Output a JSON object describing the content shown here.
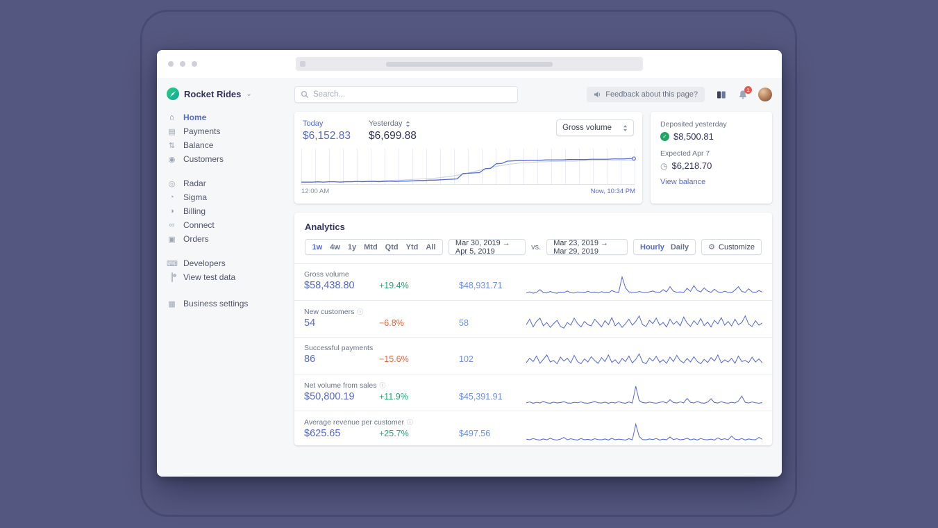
{
  "colors": {
    "accent_blue": "#5469d4",
    "compare_blue": "#6c8eef",
    "positive_green": "#1ea672",
    "negative_orange": "#e8633c",
    "brand_green": "#24b47e",
    "badge_red": "#e25950"
  },
  "icon_glyphs": {
    "home-icon": "⌂",
    "payments-icon": "▤",
    "balance-icon": "⇅",
    "customers-icon": "◉",
    "radar-icon": "◎",
    "sigma-icon": "◔",
    "billing-icon": "◑",
    "connect-icon": "∞",
    "orders-icon": "▣",
    "developers-icon": "⌨",
    "settings-icon": "▦",
    "clock-icon": "◷",
    "gear-icon": "⚙",
    "info-icon": "ⓘ",
    "check-icon": "✓",
    "chevron-down-icon": "⌄"
  },
  "topbar": {
    "search_placeholder": "Search...",
    "feedback_label": "Feedback about this page?",
    "notification_count": "1"
  },
  "sidebar": {
    "account_name": "Rocket Rides",
    "groups": [
      {
        "items": [
          {
            "label": "Home",
            "icon": "home-icon",
            "active": true
          },
          {
            "label": "Payments",
            "icon": "payments-icon"
          },
          {
            "label": "Balance",
            "icon": "balance-icon"
          },
          {
            "label": "Customers",
            "icon": "customers-icon"
          }
        ]
      },
      {
        "items": [
          {
            "label": "Radar",
            "icon": "radar-icon"
          },
          {
            "label": "Sigma",
            "icon": "sigma-icon"
          },
          {
            "label": "Billing",
            "icon": "billing-icon"
          },
          {
            "label": "Connect",
            "icon": "connect-icon"
          },
          {
            "label": "Orders",
            "icon": "orders-icon"
          }
        ]
      },
      {
        "items": [
          {
            "label": "Developers",
            "icon": "developers-icon"
          },
          {
            "label": "View test data",
            "icon": "toggle-icon"
          }
        ]
      },
      {
        "items": [
          {
            "label": "Business settings",
            "icon": "settings-icon"
          }
        ]
      }
    ]
  },
  "overview": {
    "today_label": "Today",
    "today_value": "$6,152.83",
    "yesterday_label": "Yesterday",
    "yesterday_value": "$6,699.88",
    "metric_select_value": "Gross volume",
    "x_start": "12:00 AM",
    "x_end": "Now, 10:34 PM",
    "chart": {
      "type": "line",
      "today": [
        4,
        4,
        4,
        5,
        4,
        5,
        5,
        4,
        5,
        5,
        6,
        5,
        6,
        6,
        5,
        6,
        7,
        6,
        7,
        7,
        8,
        9,
        9,
        10,
        10,
        11,
        12,
        13,
        14,
        30,
        31,
        32,
        33,
        45,
        46,
        60,
        61,
        68,
        69,
        70,
        70,
        71,
        71,
        71,
        72,
        72,
        72,
        72,
        73,
        73,
        73,
        73,
        74,
        74,
        74,
        74,
        75,
        75,
        75,
        76,
        76
      ],
      "yesterday": [
        3,
        3,
        4,
        4,
        4,
        5,
        5,
        5,
        6,
        6,
        6,
        7,
        7,
        8,
        8,
        9,
        9,
        10,
        10,
        11,
        12,
        13,
        14,
        15,
        16,
        18,
        20,
        22,
        25,
        28,
        32,
        36,
        40,
        44,
        48,
        52,
        55,
        58,
        60,
        62,
        63,
        64,
        65,
        66,
        66,
        67,
        67,
        68,
        68,
        68,
        69,
        69,
        69,
        70,
        70,
        70,
        70,
        71,
        71,
        71,
        71
      ]
    }
  },
  "deposits": {
    "deposited_label": "Deposited yesterday",
    "deposited_value": "$8,500.81",
    "expected_label": "Expected Apr 7",
    "expected_value": "$6,218.70",
    "link_label": "View balance"
  },
  "analytics": {
    "title": "Analytics",
    "periods": [
      "1w",
      "4w",
      "1y",
      "Mtd",
      "Qtd",
      "Ytd",
      "All"
    ],
    "active_period": "1w",
    "range_primary": "Mar 30, 2019 → Apr 5, 2019",
    "vs_label": "vs.",
    "range_compare": "Mar 23, 2019 → Mar 29, 2019",
    "interval_hourly": "Hourly",
    "interval_daily": "Daily",
    "active_interval": "Hourly",
    "customize_label": "Customize",
    "rows": [
      {
        "label": "Gross volume",
        "info": false,
        "value": "$58,438.80",
        "change": "+19.4%",
        "compare": "$48,931.71",
        "spark": [
          8,
          12,
          6,
          10,
          22,
          9,
          7,
          14,
          8,
          6,
          11,
          9,
          16,
          8,
          7,
          12,
          10,
          8,
          15,
          9,
          11,
          7,
          13,
          9,
          8,
          18,
          12,
          9,
          80,
          30,
          12,
          10,
          9,
          14,
          10,
          8,
          12,
          16,
          10,
          9,
          22,
          12,
          36,
          15,
          10,
          12,
          9,
          28,
          14,
          40,
          18,
          12,
          30,
          16,
          10,
          24,
          12,
          9,
          15,
          10,
          8,
          20,
          36,
          14,
          10,
          26,
          12,
          9,
          18,
          11
        ]
      },
      {
        "label": "New customers",
        "info": true,
        "value": "54",
        "change": "−6.8%",
        "compare": "58",
        "spark": [
          30,
          55,
          20,
          45,
          60,
          25,
          40,
          18,
          35,
          50,
          22,
          15,
          40,
          28,
          60,
          35,
          20,
          45,
          30,
          25,
          55,
          38,
          20,
          48,
          30,
          62,
          25,
          40,
          18,
          35,
          55,
          28,
          45,
          70,
          30,
          22,
          50,
          35,
          60,
          28,
          40,
          20,
          55,
          32,
          45,
          25,
          65,
          38,
          22,
          48,
          30,
          58,
          26,
          42,
          20,
          50,
          34,
          62,
          28,
          45,
          24,
          55,
          30,
          40,
          70,
          32,
          22,
          48,
          28,
          38
        ]
      },
      {
        "label": "Successful payments",
        "info": false,
        "value": "86",
        "change": "−15.6%",
        "compare": "102",
        "spark": [
          25,
          45,
          30,
          55,
          22,
          40,
          60,
          28,
          35,
          20,
          50,
          32,
          45,
          24,
          58,
          30,
          20,
          42,
          28,
          52,
          34,
          22,
          48,
          30,
          60,
          26,
          38,
          20,
          44,
          30,
          55,
          24,
          40,
          65,
          28,
          20,
          46,
          32,
          54,
          26,
          38,
          22,
          50,
          30,
          58,
          34,
          24,
          44,
          28,
          52,
          30,
          20,
          40,
          26,
          48,
          32,
          60,
          24,
          38,
          28,
          45,
          22,
          55,
          30,
          35,
          25,
          50,
          28,
          42,
          24
        ]
      },
      {
        "label": "Net volume from sales",
        "info": true,
        "value": "$50,800.19",
        "change": "+11.9%",
        "compare": "$45,391.91",
        "spark": [
          10,
          14,
          8,
          12,
          9,
          16,
          10,
          8,
          13,
          9,
          11,
          15,
          9,
          8,
          12,
          10,
          14,
          9,
          8,
          11,
          16,
          10,
          9,
          13,
          8,
          12,
          9,
          15,
          10,
          8,
          14,
          9,
          85,
          20,
          11,
          9,
          13,
          10,
          8,
          12,
          15,
          9,
          24,
          11,
          9,
          14,
          10,
          30,
          12,
          9,
          16,
          10,
          8,
          13,
          28,
          11,
          9,
          15,
          10,
          8,
          12,
          9,
          18,
          40,
          12,
          9,
          14,
          10,
          8,
          11
        ]
      },
      {
        "label": "Average revenue per customer",
        "info": true,
        "value": "$625.65",
        "change": "+25.7%",
        "compare": "$497.56",
        "spark": [
          12,
          9,
          15,
          10,
          8,
          13,
          9,
          16,
          10,
          8,
          12,
          20,
          9,
          14,
          10,
          8,
          15,
          9,
          11,
          8,
          14,
          10,
          9,
          13,
          8,
          16,
          9,
          12,
          10,
          8,
          14,
          9,
          80,
          24,
          10,
          9,
          13,
          10,
          15,
          8,
          12,
          9,
          22,
          10,
          14,
          9,
          11,
          16,
          9,
          13,
          8,
          15,
          10,
          9,
          12,
          8,
          18,
          10,
          14,
          9,
          26,
          12,
          9,
          15,
          8,
          13,
          10,
          9,
          20,
          11
        ]
      }
    ]
  }
}
